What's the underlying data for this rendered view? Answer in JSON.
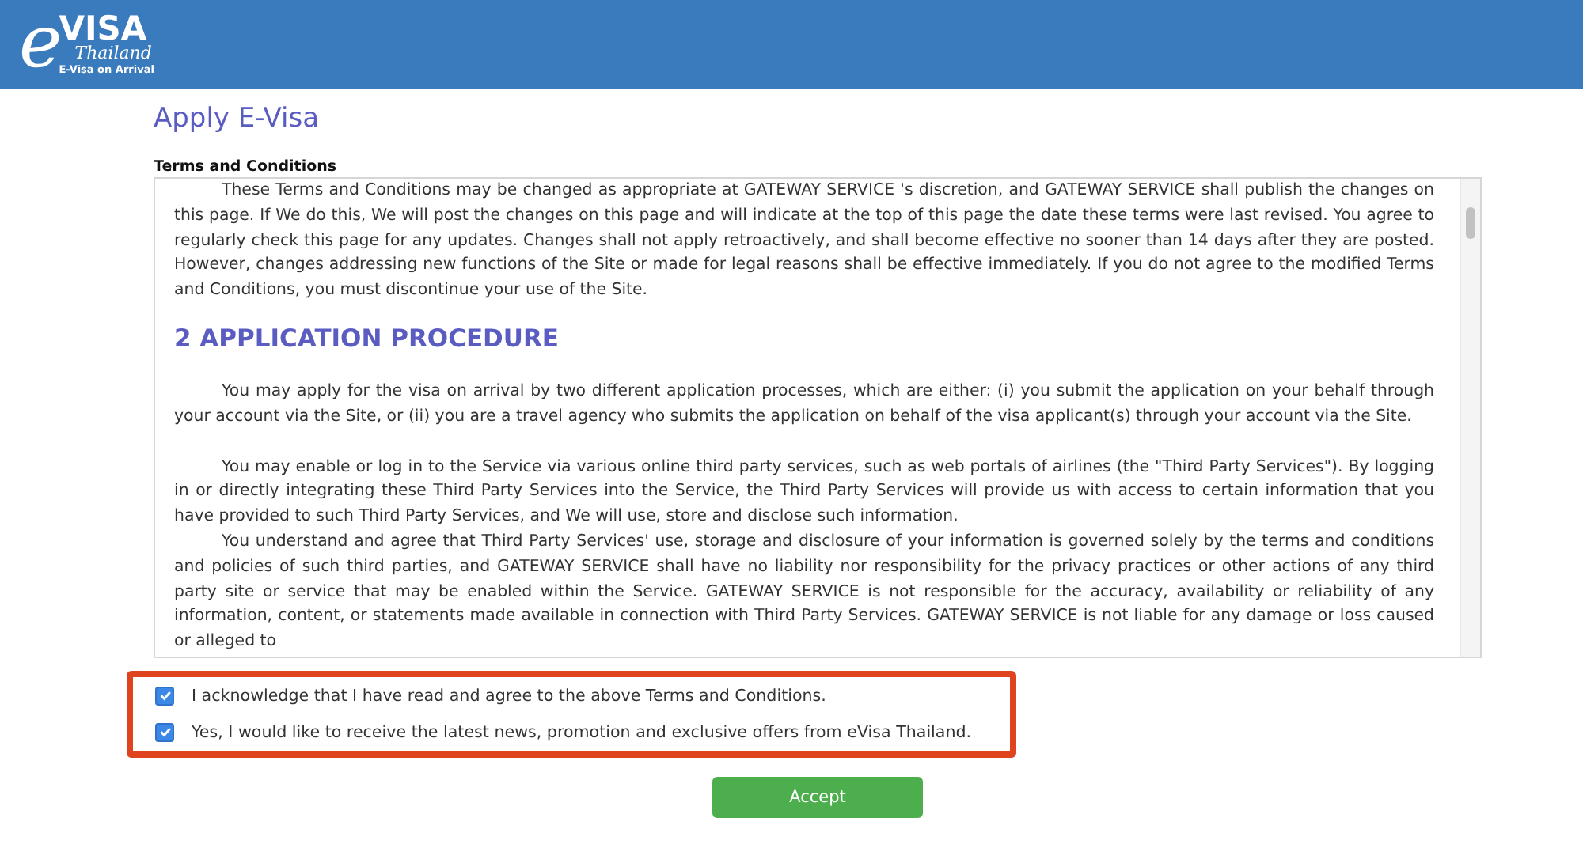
{
  "header": {
    "logo": {
      "letter": "e",
      "word": "VISA",
      "country": "Thailand",
      "tagline": "E-Visa on Arrival"
    }
  },
  "page_title": "Apply E-Visa",
  "terms": {
    "heading": "Terms and Conditions",
    "blocks": [
      {
        "kind": "paragraph",
        "text": "These Terms and Conditions may be changed as appropriate at GATEWAY SERVICE 's discretion, and GATEWAY SERVICE shall publish the changes on this page. If We do this, We will post the changes on this page and will indicate at the top of this page the date these terms were last revised. You agree to regularly check this page for any updates. Changes shall not apply retroactively, and shall become effective no sooner than 14 days after they are posted. However, changes addressing new functions of the Site or made for legal reasons shall be effective immediately. If you do not agree to the modified Terms and Conditions, you must discontinue your use of the Site."
      },
      {
        "kind": "heading",
        "text": "2 APPLICATION PROCEDURE"
      },
      {
        "kind": "paragraph",
        "text": "You may apply for the visa on arrival by two different application processes, which are either: (i) you submit the application on your behalf through your account via the Site, or (ii) you are a travel agency who submits the application on behalf of the visa applicant(s) through your account via the Site."
      },
      {
        "kind": "paragraph",
        "text": "You may enable or log in to the Service via various online third party services, such as web portals of airlines (the \"Third Party Services\"). By logging in or directly integrating these Third Party Services into the Service, the Third Party Services will provide us with access to certain information that you have provided to such Third Party Services, and We will use, store and disclose such information."
      },
      {
        "kind": "continuation",
        "text": "You understand and agree that Third Party Services' use, storage and disclosure of your information is governed solely by the terms and conditions and policies of such third parties, and GATEWAY SERVICE shall have no liability nor responsibility for the privacy practices or other actions of any third party site or service that may be enabled within the Service. GATEWAY SERVICE is not responsible for the accuracy, availability or reliability of any information, content, or statements made available in connection with Third Party Services. GATEWAY SERVICE is not liable for any damage or loss caused or alleged to"
      }
    ]
  },
  "consents": [
    {
      "label": "I acknowledge that I have read and agree to the above Terms and Conditions.",
      "checked": true
    },
    {
      "label": "Yes, I would like to receive the latest news, promotion and exclusive offers from eVisa Thailand.",
      "checked": true
    }
  ],
  "accept_button": "Accept"
}
